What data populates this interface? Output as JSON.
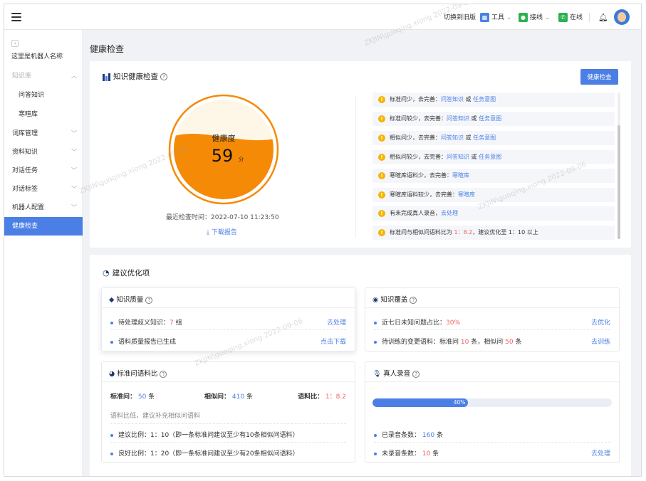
{
  "topbar": {
    "switch_old": "切换到旧版",
    "tools": "工具",
    "takeover": "接线",
    "online": "在线"
  },
  "sidebar": {
    "robot_name": "这里是机器人名称",
    "items": [
      {
        "label": "知识库",
        "state": "expanded-header"
      },
      {
        "label": "问答知识",
        "state": "sub"
      },
      {
        "label": "寒暄库",
        "state": "sub"
      },
      {
        "label": "词库管理",
        "state": "collapsed"
      },
      {
        "label": "资料知识",
        "state": "collapsed"
      },
      {
        "label": "对话任务",
        "state": "collapsed"
      },
      {
        "label": "对话标签",
        "state": "collapsed"
      },
      {
        "label": "机器人配置",
        "state": "collapsed"
      },
      {
        "label": "健康检查",
        "state": "active"
      }
    ]
  },
  "page": {
    "title": "健康检查"
  },
  "health": {
    "title": "知识健康检查",
    "button": "健康检查",
    "gauge_label": "健康度",
    "score": "59",
    "score_unit": "分",
    "score_value": 59,
    "last_check": "最近检查时间：2022-07-10 11:23:50",
    "download": "下载报告",
    "alerts": [
      {
        "text": "标准问少，去完善：",
        "link1": "问答知识",
        "sep": "或",
        "link2": "任务意图"
      },
      {
        "text": "标准问较少，去完善：",
        "link1": "问答知识",
        "sep": "或",
        "link2": "任务意图"
      },
      {
        "text": "相似问少，去完善：",
        "link1": "问答知识",
        "sep": "或",
        "link2": "任务意图"
      },
      {
        "text": "相似问较少，去完善：",
        "link1": "问答知识",
        "sep": "或",
        "link2": "任务意图"
      },
      {
        "text": "寒暄库语料少，去完善：",
        "link1": "寒暄库",
        "sep": "",
        "link2": ""
      },
      {
        "text": "寒暄库语料较少，去完善：",
        "link1": "寒暄库",
        "sep": "",
        "link2": ""
      },
      {
        "text": "有未完成真人录音，",
        "link1": "去处理",
        "sep": "",
        "link2": ""
      },
      {
        "text": "标准问与相似问语料比为",
        "ratio": "1：8.2",
        "tail": "，建议优化至 1：10 以上"
      }
    ]
  },
  "optimize": {
    "title": "建议优化项",
    "quality": {
      "title": "知识质量",
      "row1_label": "待处理歧义知识：",
      "row1_value": "7",
      "row1_unit": "组",
      "row1_link": "去处理",
      "row2_label": "语料质量报告已生成",
      "row2_link": "点击下载"
    },
    "coverage": {
      "title": "知识覆盖",
      "row1_label": "近七日未知问题占比：",
      "row1_value": "30%",
      "row1_link": "去优化",
      "row2_label": "待训练的变更语料：标准问",
      "row2_v1": "10",
      "row2_mid": "条，相似问",
      "row2_v2": "50",
      "row2_tail": "条",
      "row2_link": "去训练"
    },
    "ratio": {
      "title": "标准问语料比",
      "std_label": "标准问：",
      "std_value": "50",
      "std_unit": "条",
      "sim_label": "相似问：",
      "sim_value": "410",
      "sim_unit": "条",
      "ratio_label": "语料比：",
      "ratio_value": "1：8.2",
      "hint": "语料比低，建议补充相似问语料",
      "suggest": "建议比例：1：10（即一条标准问建议至少有10条相似问语料）",
      "good": "良好比例：1：20（即一条标准问建议至少有20条相似问语料）"
    },
    "recording": {
      "title": "真人录音",
      "progress_label": "40%",
      "progress_value": 0.4,
      "recorded_label": "已录音条数：",
      "recorded_value": "160",
      "recorded_unit": "条",
      "unrecorded_label": "未录音条数：",
      "unrecorded_value": "10",
      "unrecorded_unit": "条",
      "link": "去处理"
    }
  },
  "watermark": "ZKJIN\\guoqing.xiong 2022-09-06",
  "colors": {
    "primary": "#4b7fe5",
    "warning": "#f5b400",
    "danger": "#f0615e",
    "gauge_fill": "#f58a07",
    "gauge_bg": "#fef6e6"
  }
}
